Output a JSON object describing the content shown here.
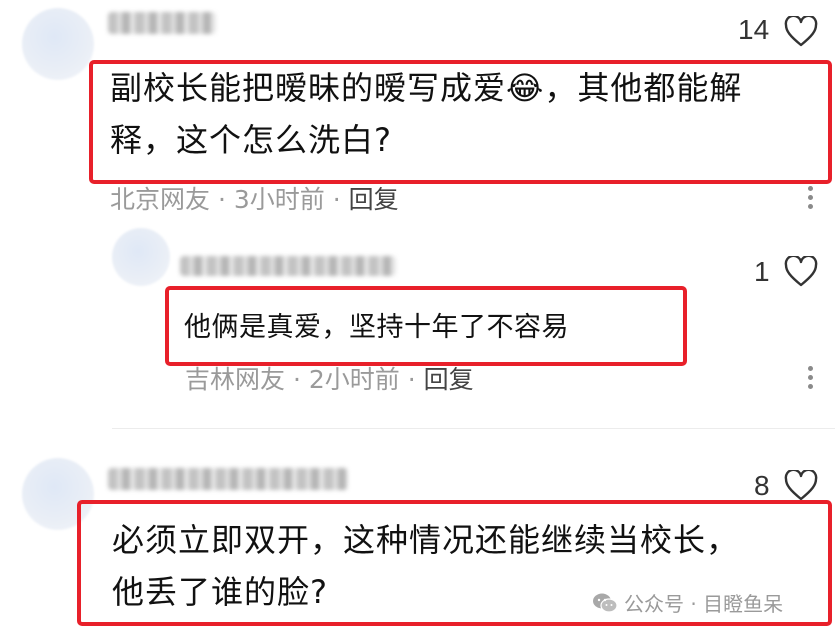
{
  "comments": [
    {
      "likes": "14",
      "text": "副校长能把暧昧的暧写成爱😂，其他都能解释，这个怎么洗白?",
      "line1": "副校长能把暧昧的暧写成爱😂，其他都能解",
      "line2": "释，这个怎么洗白?",
      "location": "北京网友",
      "time": "3小时前",
      "reply_label": "回复",
      "sep": "·"
    },
    {
      "likes": "1",
      "text": "他俩是真爱，坚持十年了不容易",
      "location": "吉林网友",
      "time": "2小时前",
      "reply_label": "回复",
      "sep": "·"
    },
    {
      "likes": "8",
      "text": "必须立即双开，这种情况还能继续当校长，他丢了谁的脸?",
      "line1": "必须立即双开，这种情况还能继续当校长，",
      "line2": "他丢了谁的脸?"
    }
  ],
  "watermark": {
    "label": "公众号 · 目瞪鱼呆",
    "icon": "wechat-icon"
  },
  "colors": {
    "highlight_border": "#e8202a",
    "meta_text": "#9a9a9a"
  }
}
